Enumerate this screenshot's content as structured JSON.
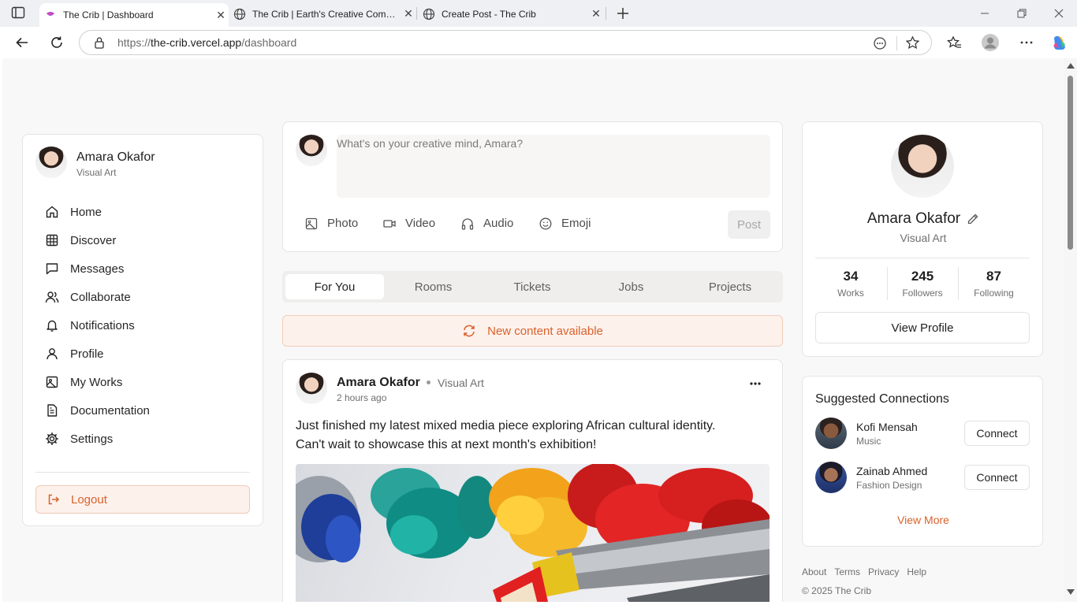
{
  "browser": {
    "tabs": [
      {
        "title": "The Crib | Dashboard",
        "active": true
      },
      {
        "title": "The Crib | Earth's Creative Community",
        "active": false
      },
      {
        "title": "Create Post - The Crib",
        "active": false
      }
    ],
    "url": {
      "prefix": "https://",
      "host": "the-crib.vercel.app",
      "path": "/dashboard"
    }
  },
  "sidebar": {
    "user_name": "Amara Okafor",
    "user_role": "Visual Art",
    "items": [
      {
        "label": "Home",
        "icon": "home-icon"
      },
      {
        "label": "Discover",
        "icon": "grid-icon"
      },
      {
        "label": "Messages",
        "icon": "message-icon"
      },
      {
        "label": "Collaborate",
        "icon": "users-icon"
      },
      {
        "label": "Notifications",
        "icon": "bell-icon"
      },
      {
        "label": "Profile",
        "icon": "user-icon"
      },
      {
        "label": "My Works",
        "icon": "image-icon"
      },
      {
        "label": "Documentation",
        "icon": "document-icon"
      },
      {
        "label": "Settings",
        "icon": "gear-icon"
      }
    ],
    "logout_label": "Logout"
  },
  "composer": {
    "placeholder": "What's on your creative mind, Amara?",
    "actions": [
      "Photo",
      "Video",
      "Audio",
      "Emoji"
    ],
    "post_label": "Post"
  },
  "feed_tabs": [
    "For You",
    "Rooms",
    "Tickets",
    "Jobs",
    "Projects"
  ],
  "new_content_label": "New content available",
  "post": {
    "author": "Amara Okafor",
    "category": "Visual Art",
    "time": "2 hours ago",
    "text_line1": "Just finished my latest mixed media piece exploring African cultural identity.",
    "text_line2": "Can't wait to showcase this at next month's exhibition!",
    "more_icon": "more-horizontal-icon"
  },
  "profile_card": {
    "name": "Amara Okafor",
    "role": "Visual Art",
    "stats": [
      {
        "value": "34",
        "label": "Works"
      },
      {
        "value": "245",
        "label": "Followers"
      },
      {
        "value": "87",
        "label": "Following"
      }
    ],
    "view_profile_label": "View Profile"
  },
  "suggestions": {
    "title": "Suggested Connections",
    "people": [
      {
        "name": "Kofi Mensah",
        "field": "Music",
        "action": "Connect"
      },
      {
        "name": "Zainab Ahmed",
        "field": "Fashion Design",
        "action": "Connect"
      }
    ],
    "view_more_label": "View More"
  },
  "footer": {
    "links": [
      "About",
      "Terms",
      "Privacy",
      "Help"
    ],
    "copyright": "© 2025 The Crib"
  },
  "colors": {
    "accent": "#d9622b",
    "accent_bg": "#fdf1ec"
  }
}
